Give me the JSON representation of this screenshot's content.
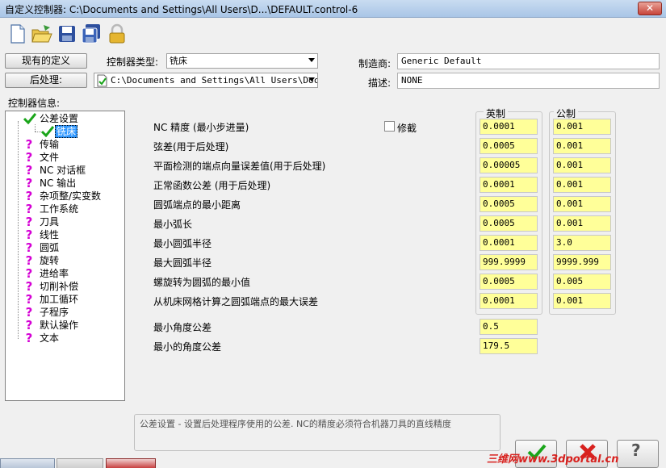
{
  "window": {
    "title": "自定义控制器: C:\\Documents and Settings\\All Users\\D...\\DEFAULT.control-6",
    "close_glyph": "✕"
  },
  "toolbar": {
    "icons": [
      "new-file-icon",
      "open-folder-icon",
      "save-icon",
      "save-all-icon",
      "lock-icon"
    ]
  },
  "header": {
    "existing_definition_button": "现有的定义",
    "post_button": "后处理:",
    "controller_type_label": "控制器类型:",
    "controller_type_value": "铣床",
    "post_path_value": "C:\\Documents and Settings\\All Users\\Docu",
    "manufacturer_label": "制造商:",
    "manufacturer_value": "Generic Default",
    "description_label": "描述:",
    "description_value": "NONE"
  },
  "tree": {
    "label": "控制器信息:",
    "root": "公差设置",
    "child": "铣床",
    "items": [
      "传输",
      "文件",
      "NC 对话框",
      "NC 输出",
      "杂项整/实变数",
      "工作系统",
      "刀具",
      "线性",
      "圆弧",
      "旋转",
      "进给率",
      "切削补偿",
      "加工循环",
      "子程序",
      "默认操作",
      "文本"
    ]
  },
  "params": {
    "inch_header": "英制",
    "metric_header": "公制",
    "trim_label": "修截",
    "rows": [
      {
        "label": "NC 精度 (最小步进量)",
        "inch": "0.0001",
        "metric": "0.001"
      },
      {
        "label": "弦差(用于后处理)",
        "inch": "0.0005",
        "metric": "0.001"
      },
      {
        "label": "平面检测的端点向量误差值(用于后处理)",
        "inch": "0.00005",
        "metric": "0.001"
      },
      {
        "label": "正常函数公差  (用于后处理)",
        "inch": "0.0001",
        "metric": "0.001"
      },
      {
        "label": "圆弧端点的最小距离",
        "inch": "0.0005",
        "metric": "0.001"
      },
      {
        "label": "最小弧长",
        "inch": "0.0005",
        "metric": "0.001"
      },
      {
        "label": "最小圆弧半径",
        "inch": "0.0001",
        "metric": "3.0"
      },
      {
        "label": "最大圆弧半径",
        "inch": "999.9999",
        "metric": "9999.999"
      },
      {
        "label": "螺旋转为圆弧的最小值",
        "inch": "0.0005",
        "metric": "0.005"
      },
      {
        "label": "从机床网格计算之圆弧端点的最大误差",
        "inch": "0.0001",
        "metric": "0.001"
      }
    ],
    "angle_rows": [
      {
        "label": "最小角度公差",
        "value": "0.5"
      },
      {
        "label": "最小的角度公差",
        "value": "179.5"
      }
    ]
  },
  "footer": {
    "description": "公差设置 - 设置后处理程序使用的公差. NC的精度必须符合机器刀具的直线精度",
    "ok_glyph": "✔",
    "cancel_glyph": "✖",
    "help_glyph": "?",
    "watermark": "三维网www.3dportal.cn"
  },
  "colors": {
    "field_yellow": "#ffff99",
    "check_green": "#1aa51a",
    "question_magenta": "#d400d4",
    "cancel_red": "#d8211e"
  }
}
